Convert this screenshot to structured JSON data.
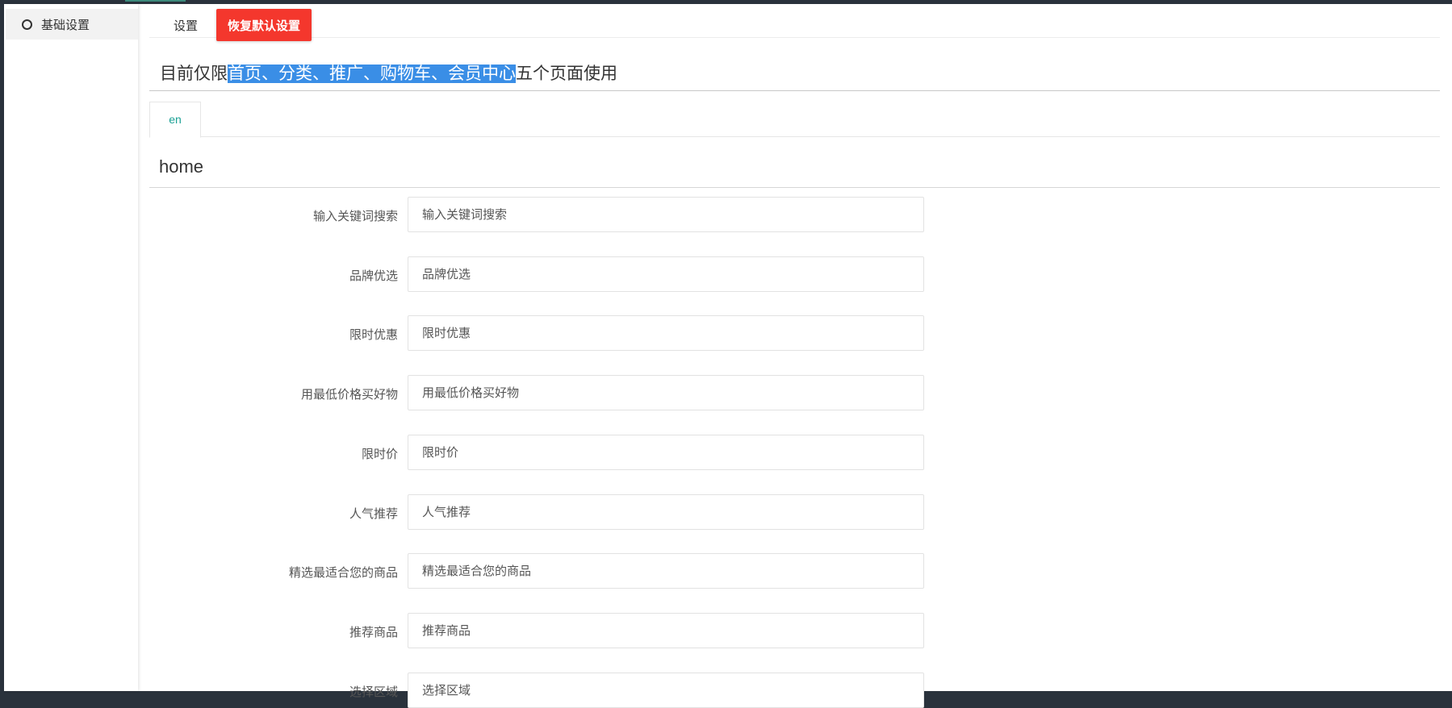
{
  "sidebar": {
    "items": [
      {
        "label": "基础设置"
      }
    ]
  },
  "tabs": {
    "settings_label": "设置",
    "restore_label": "恢复默认设置"
  },
  "notice": {
    "prefix": "目前仅限",
    "highlight": "首页、分类、推广、购物车、会员中心",
    "suffix": "五个页面使用"
  },
  "lang_tabs": [
    {
      "label": "en"
    }
  ],
  "section": {
    "title": "home"
  },
  "fields": [
    {
      "label": "输入关键词搜索",
      "placeholder": "输入关键词搜索"
    },
    {
      "label": "品牌优选",
      "placeholder": "品牌优选"
    },
    {
      "label": "限时优惠",
      "placeholder": "限时优惠"
    },
    {
      "label": "用最低价格买好物",
      "placeholder": "用最低价格买好物"
    },
    {
      "label": "限时价",
      "placeholder": "限时价"
    },
    {
      "label": "人气推荐",
      "placeholder": "人气推荐"
    },
    {
      "label": "精选最适合您的商品",
      "placeholder": "精选最适合您的商品"
    },
    {
      "label": "推荐商品",
      "placeholder": "推荐商品"
    },
    {
      "label": "选择区域",
      "placeholder": "选择区域"
    }
  ],
  "colors": {
    "accent": "#1aa094",
    "danger": "#f4372d",
    "highlight": "#3a8ee6",
    "frame": "#2a323c"
  }
}
